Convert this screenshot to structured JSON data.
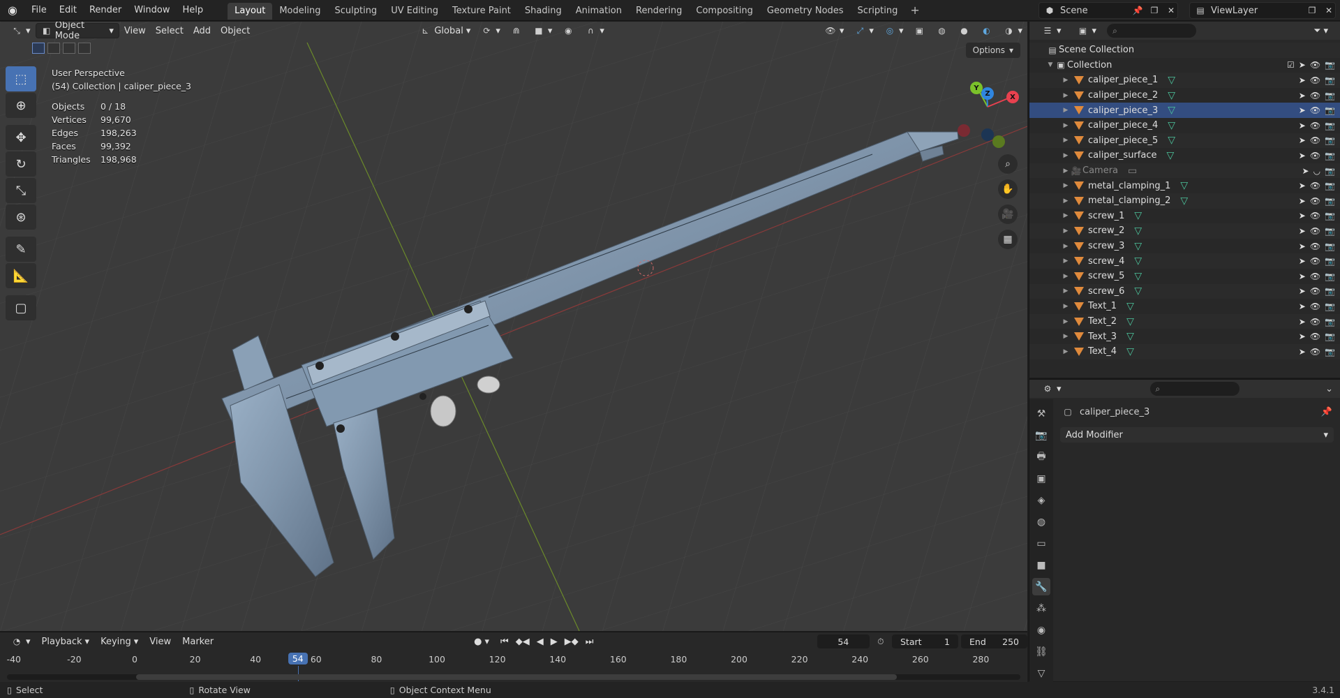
{
  "topbar": {
    "menus": [
      "File",
      "Edit",
      "Render",
      "Window",
      "Help"
    ],
    "workspaces": [
      "Layout",
      "Modeling",
      "Sculpting",
      "UV Editing",
      "Texture Paint",
      "Shading",
      "Animation",
      "Rendering",
      "Compositing",
      "Geometry Nodes",
      "Scripting"
    ],
    "active_workspace": "Layout",
    "add_tab": "+",
    "scene": "Scene",
    "view_layer": "ViewLayer"
  },
  "viewport": {
    "mode": "Object Mode",
    "menus": [
      "View",
      "Select",
      "Add",
      "Object"
    ],
    "orientation": "Global",
    "options_label": "Options",
    "perspective": "User Perspective",
    "collection_line": "(54) Collection | caliper_piece_3",
    "stats": [
      {
        "label": "Objects",
        "value": "0 / 18"
      },
      {
        "label": "Vertices",
        "value": "99,670"
      },
      {
        "label": "Edges",
        "value": "198,263"
      },
      {
        "label": "Faces",
        "value": "99,392"
      },
      {
        "label": "Triangles",
        "value": "198,968"
      }
    ],
    "gizmo": {
      "x": "X",
      "y": "Y",
      "z": "Z"
    },
    "colors": {
      "x": "#e8414f",
      "y": "#7bc12a",
      "z": "#2f86e0",
      "bg": "#3b3b3b"
    }
  },
  "timeline": {
    "menus": [
      "Playback",
      "Keying",
      "View",
      "Marker"
    ],
    "current_frame": "54",
    "start_label": "Start",
    "start": "1",
    "end_label": "End",
    "end": "250",
    "ticks": [
      "-40",
      "-20",
      "0",
      "20",
      "40",
      "60",
      "80",
      "100",
      "120",
      "140",
      "160",
      "180",
      "200",
      "220",
      "240",
      "260",
      "280"
    ],
    "playhead": "54"
  },
  "statusbar": {
    "items": [
      "Select",
      "Rotate View",
      "Object Context Menu"
    ],
    "version": "3.4.1"
  },
  "outliner": {
    "scene_collection": "Scene Collection",
    "collection": "Collection",
    "items": [
      {
        "name": "caliper_piece_1",
        "type": "mesh"
      },
      {
        "name": "caliper_piece_2",
        "type": "mesh"
      },
      {
        "name": "caliper_piece_3",
        "type": "mesh",
        "active": true
      },
      {
        "name": "caliper_piece_4",
        "type": "mesh"
      },
      {
        "name": "caliper_piece_5",
        "type": "mesh"
      },
      {
        "name": "caliper_surface",
        "type": "mesh"
      },
      {
        "name": "Camera",
        "type": "camera",
        "disabled": true
      },
      {
        "name": "metal_clamping_1",
        "type": "mesh"
      },
      {
        "name": "metal_clamping_2",
        "type": "mesh"
      },
      {
        "name": "screw_1",
        "type": "mesh"
      },
      {
        "name": "screw_2",
        "type": "mesh"
      },
      {
        "name": "screw_3",
        "type": "mesh"
      },
      {
        "name": "screw_4",
        "type": "mesh"
      },
      {
        "name": "screw_5",
        "type": "mesh"
      },
      {
        "name": "screw_6",
        "type": "mesh"
      },
      {
        "name": "Text_1",
        "type": "mesh"
      },
      {
        "name": "Text_2",
        "type": "mesh"
      },
      {
        "name": "Text_3",
        "type": "mesh"
      },
      {
        "name": "Text_4",
        "type": "mesh"
      }
    ]
  },
  "properties": {
    "object_name": "caliper_piece_3",
    "add_modifier": "Add Modifier",
    "tabs": [
      "tool-icon",
      "render-icon",
      "output-icon",
      "view-layer-icon",
      "scene-icon",
      "world-icon",
      "collection-icon",
      "object-icon",
      "modifier-icon",
      "particles-icon",
      "physics-icon",
      "constraints-icon",
      "data-icon"
    ],
    "active_tab": "modifier-icon"
  }
}
